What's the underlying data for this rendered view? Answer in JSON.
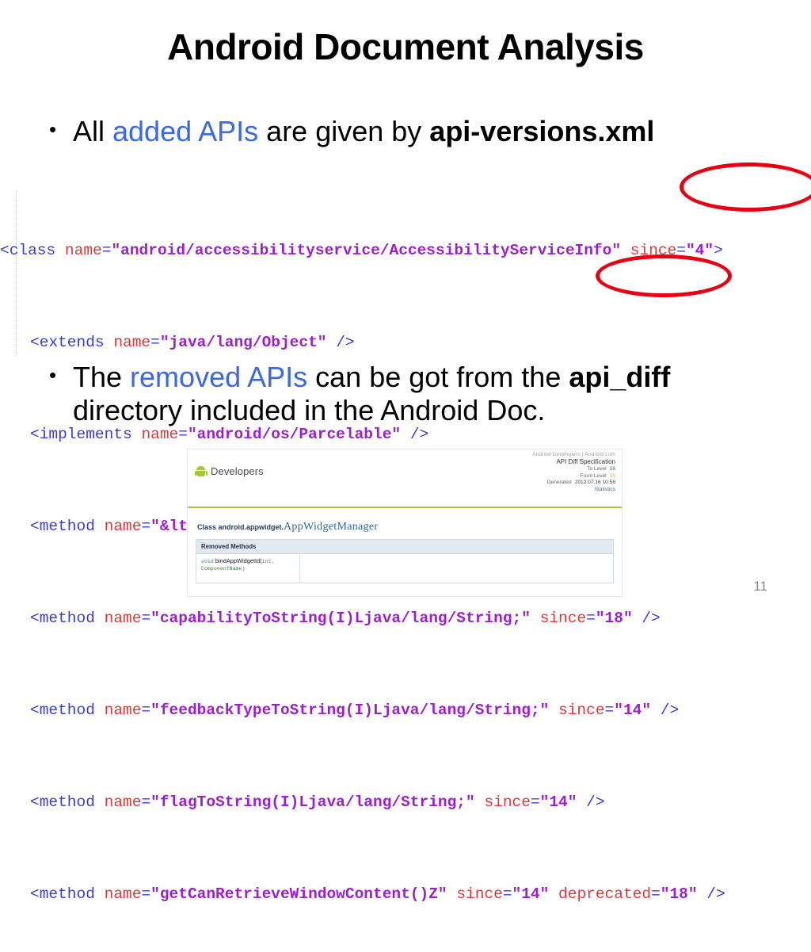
{
  "slide": {
    "title": "Android Document Analysis",
    "page_number": "11"
  },
  "bullets": [
    {
      "marker": "•",
      "seg_1": "All ",
      "seg_2_highlight": "added APIs",
      "seg_3": " are given by ",
      "seg_4_bold": "api-versions.xml"
    },
    {
      "marker": "•",
      "seg_1": "The ",
      "seg_2_highlight": "removed APIs",
      "seg_3": " can be got from the ",
      "seg_4_bold": "api_diff",
      "seg_5": " directory included in the Android Doc."
    }
  ],
  "code": {
    "lines": [
      {
        "open": "<class",
        "attr1": "name",
        "val1": "\"android/accessibilityservice/AccessibilityServiceInfo\"",
        "attr2": "since",
        "val2": "\"4\"",
        "close": ">"
      },
      {
        "open": "<extends",
        "attr1": "name",
        "val1": "\"java/lang/Object\"",
        "close": "/>"
      },
      {
        "open": "<implements",
        "attr1": "name",
        "val1": "\"android/os/Parcelable\"",
        "close": "/>"
      },
      {
        "open": "<method",
        "attr1": "name",
        "val1": "\"&lt;init>()V\"",
        "close": "/>"
      },
      {
        "open": "<method",
        "attr1": "name",
        "val1": "\"capabilityToString(I)Ljava/lang/String;\"",
        "attr2": "since",
        "val2": "\"18\"",
        "close": "/>"
      },
      {
        "open": "<method",
        "attr1": "name",
        "val1": "\"feedbackTypeToString(I)Ljava/lang/String;\"",
        "attr2": "since",
        "val2": "\"14\"",
        "close": "/>"
      },
      {
        "open": "<method",
        "attr1": "name",
        "val1": "\"flagToString(I)Ljava/lang/String;\"",
        "attr2": "since",
        "val2": "\"14\"",
        "close": "/>"
      },
      {
        "open": "<method",
        "attr1": "name",
        "val1": "\"getCanRetrieveWindowContent()Z\"",
        "attr2": "since",
        "val2": "\"14\"",
        "attr3": "deprecated",
        "val3": "\"18\"",
        "close": "/>"
      }
    ]
  },
  "annotations": {
    "circle_color": "#e60012",
    "circle_1_target": "since=\"4\">",
    "circle_2_target": "since=\"18\""
  },
  "embedded_screenshot": {
    "corp_link": "Android Developers | Android.com",
    "brand_label": "Developers",
    "diff_panel": {
      "title": "API Diff Specification",
      "to_level_label": "To Level",
      "to_level_value": "16",
      "from_level_label": "From Level",
      "from_level_value": "15",
      "generated_label": "Generated",
      "generated_value": "2012.07.16 10:58",
      "statistics_link": "Statistics"
    },
    "class_prefix": "Class android.appwidget.",
    "class_name": "AppWidgetManager",
    "table": {
      "header": "Removed Methods",
      "rows": [
        {
          "ret": "void",
          "sig_name": " bindAppWidgetId(",
          "args": "int, ComponentName)"
        }
      ]
    }
  },
  "colors": {
    "highlight_blue": "#3a68e8",
    "xml_tag": "#3b3bd6",
    "xml_attr": "#e2373a",
    "xml_value": "#9a1fcf",
    "android_green": "#a4c639"
  }
}
